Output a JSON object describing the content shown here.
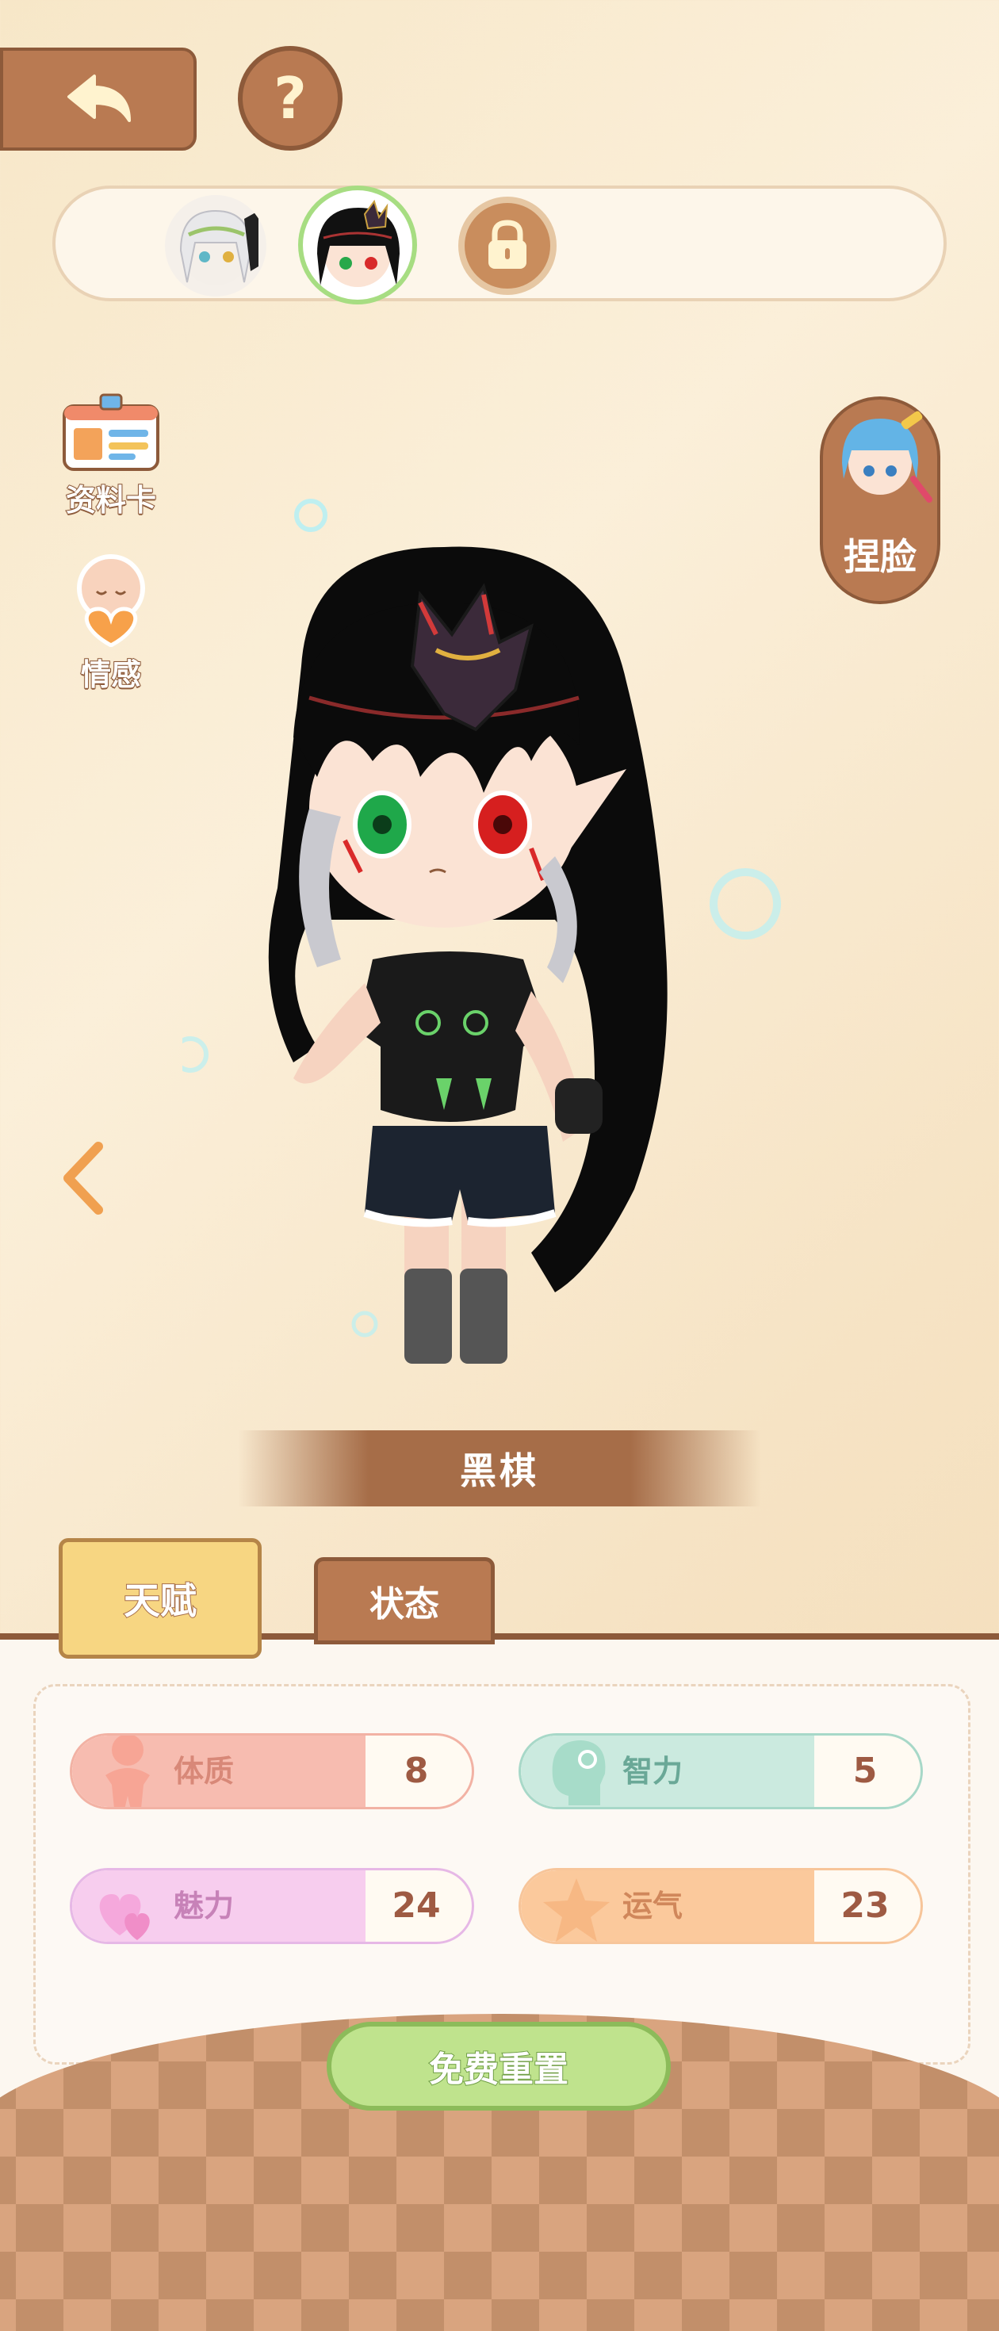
{
  "header": {
    "back_icon": "back-arrow-icon",
    "help_icon": "question-icon",
    "help_label": "?"
  },
  "character_slots": [
    {
      "name": "white-hair-avatar",
      "locked": false
    },
    {
      "name": "black-hair-avatar",
      "locked": false,
      "selected": true
    },
    {
      "name": "locked-slot",
      "locked": true
    }
  ],
  "side_menu": {
    "profile_label": "资料卡",
    "emotion_label": "情感"
  },
  "face_button": {
    "label": "捏脸"
  },
  "character": {
    "name": "黑棋"
  },
  "tabs": {
    "talent": "天赋",
    "status": "状态",
    "active": "talent"
  },
  "stats": {
    "constitution": {
      "label": "体质",
      "value": "8"
    },
    "intelligence": {
      "label": "智力",
      "value": "5"
    },
    "charm": {
      "label": "魅力",
      "value": "24"
    },
    "luck": {
      "label": "运气",
      "value": "23"
    }
  },
  "footer": {
    "reset_label": "免费重置"
  },
  "colors": {
    "brown": "#b97a52",
    "green": "#bfe38d",
    "background": "#f7e7c8"
  }
}
